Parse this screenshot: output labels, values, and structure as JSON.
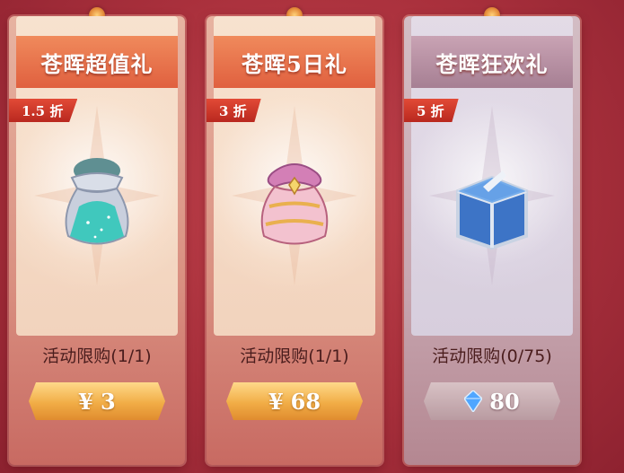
{
  "packs": [
    {
      "title": "苍晖超值礼",
      "discount": "1.5 折",
      "item_icon": "teal-gift-bag-icon",
      "limit": "活动限购(1/1)",
      "currency": "¥",
      "price": "3",
      "theme": "warm"
    },
    {
      "title": "苍晖5日礼",
      "discount": "3 折",
      "item_icon": "pink-gift-bag-icon",
      "limit": "活动限购(1/1)",
      "currency": "¥",
      "price": "68",
      "theme": "warm"
    },
    {
      "title": "苍晖狂欢礼",
      "discount": "5 折",
      "item_icon": "blue-treasure-chest-icon",
      "limit": "活动限购(0/75)",
      "currency_icon": "diamond-icon",
      "price": "80",
      "theme": "cool"
    }
  ],
  "colors": {
    "background": "#a9303c",
    "banner_warm": "#e0603f",
    "banner_cool": "#a67f93",
    "badge": "#b9281f",
    "price_gold": "#f1ad46"
  }
}
